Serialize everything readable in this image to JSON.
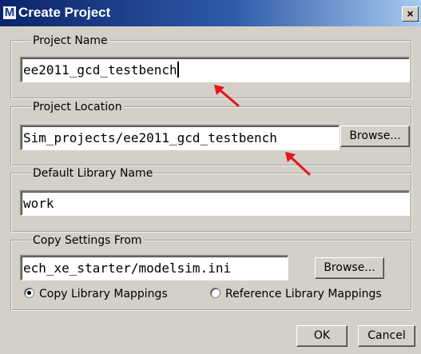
{
  "dialog": {
    "title": "Create Project",
    "app_icon_letter": "M",
    "close_glyph": "×"
  },
  "project_name": {
    "legend": "Project Name",
    "value": "ee2011_gcd_testbench"
  },
  "project_location": {
    "legend": "Project Location",
    "value": "Sim_projects/ee2011_gcd_testbench",
    "browse_label": "Browse..."
  },
  "default_library": {
    "legend": "Default Library Name",
    "value": "work"
  },
  "copy_settings": {
    "legend": "Copy Settings From",
    "value": "ech_xe_starter/modelsim.ini",
    "browse_label": "Browse...",
    "options": [
      {
        "label": "Copy Library Mappings",
        "selected": true
      },
      {
        "label": "Reference Library Mappings",
        "selected": false
      }
    ]
  },
  "footer": {
    "ok_label": "OK",
    "cancel_label": "Cancel"
  },
  "annotation_color": "#e8141b"
}
